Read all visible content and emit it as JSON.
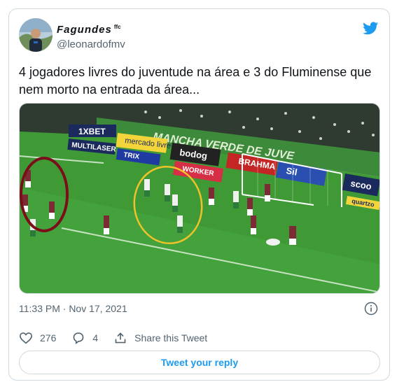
{
  "tweet": {
    "display_name": "Fagundes",
    "name_badge": "ffc",
    "handle": "@leonardofmv",
    "text": "4 jogadores livres do juventude na área e 3 do Fluminense que nem morto na entrada da área...",
    "timestamp": "11:33 PM · Nov 17, 2021"
  },
  "media": {
    "banners": [
      "1XBET",
      "MULTILASER",
      "mercado livre",
      "TRIX",
      "bodog",
      "WORKER",
      "BRAHMA",
      "Sil",
      "scoo",
      "quartzo",
      "MANCHA VERDE DE JUVE"
    ]
  },
  "actions": {
    "likes": "276",
    "replies": "4",
    "share_label": "Share this Tweet"
  },
  "reply_button": {
    "label": "Tweet your reply"
  },
  "colors": {
    "accent": "#1d9bf0",
    "muted": "#536471",
    "border": "#cfd9de"
  }
}
